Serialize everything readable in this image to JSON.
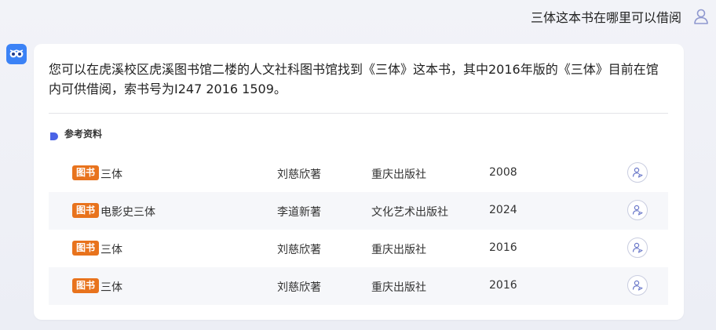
{
  "chat": {
    "user_message": "三体这本书在哪里可以借阅",
    "answer_line1": "您可以在虎溪校区虎溪图书馆二楼的人文社科图书馆找到《三体》这本书，其中2016年版的《三体》目前在馆",
    "answer_line2": "内可供借阅，索书号为I247 2016 1509。",
    "refs_title": "参考资料"
  },
  "references": [
    {
      "badge": "图书",
      "title": "三体",
      "author": "刘慈欣著",
      "publisher": "重庆出版社",
      "year": "2008"
    },
    {
      "badge": "图书",
      "title": "电影史三体",
      "author": "李道新著",
      "publisher": "文化艺术出版社",
      "year": "2024"
    },
    {
      "badge": "图书",
      "title": "三体",
      "author": "刘慈欣著",
      "publisher": "重庆出版社",
      "year": "2016"
    },
    {
      "badge": "图书",
      "title": "三体",
      "author": "刘慈欣著",
      "publisher": "重庆出版社",
      "year": "2016"
    }
  ],
  "colors": {
    "badge": "#e8731d",
    "accent": "#3b82f6",
    "refs_dot": "#4a63e6"
  },
  "icons": {
    "user_avatar": "user-outline-icon",
    "bot_avatar": "owl-icon",
    "row_action": "person-locate-icon",
    "refs_marker": "flag-dot-icon"
  }
}
